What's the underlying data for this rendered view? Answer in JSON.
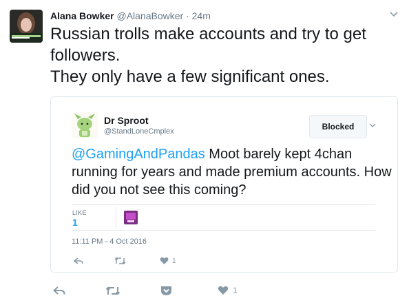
{
  "tweet": {
    "author_name": "Alana Bowker",
    "author_handle": "@AlanaBowker",
    "separator": "·",
    "time": "24m",
    "text_lines": [
      "Russian trolls make accounts and try to get followers.",
      "They only have a few significant ones."
    ],
    "avatar_banner_text": "BKRF",
    "actions": {
      "reply_icon": "reply-icon",
      "retweet_icon": "retweet-icon",
      "pocket_icon": "pocket-icon",
      "like_icon": "heart-icon",
      "like_count": "1"
    }
  },
  "quoted": {
    "name": "Dr Sproot",
    "handle": "@StandLoneCmplex",
    "blocked_label": "Blocked",
    "mention": "@GamingAndPandas",
    "text": " Moot barely kept 4chan running for years and made premium accounts. How did you not see this coming?",
    "like_label": "LIKE",
    "like_count": "1",
    "date": "11:11 PM - 4 Oct 2016",
    "actions": {
      "reply_icon": "reply-icon",
      "retweet_icon": "retweet-icon",
      "like_icon": "heart-icon",
      "like_count": "1"
    }
  },
  "colors": {
    "link": "#1da1f2",
    "muted": "#657786",
    "icon": "#8899a6",
    "border": "#e1e8ed"
  }
}
